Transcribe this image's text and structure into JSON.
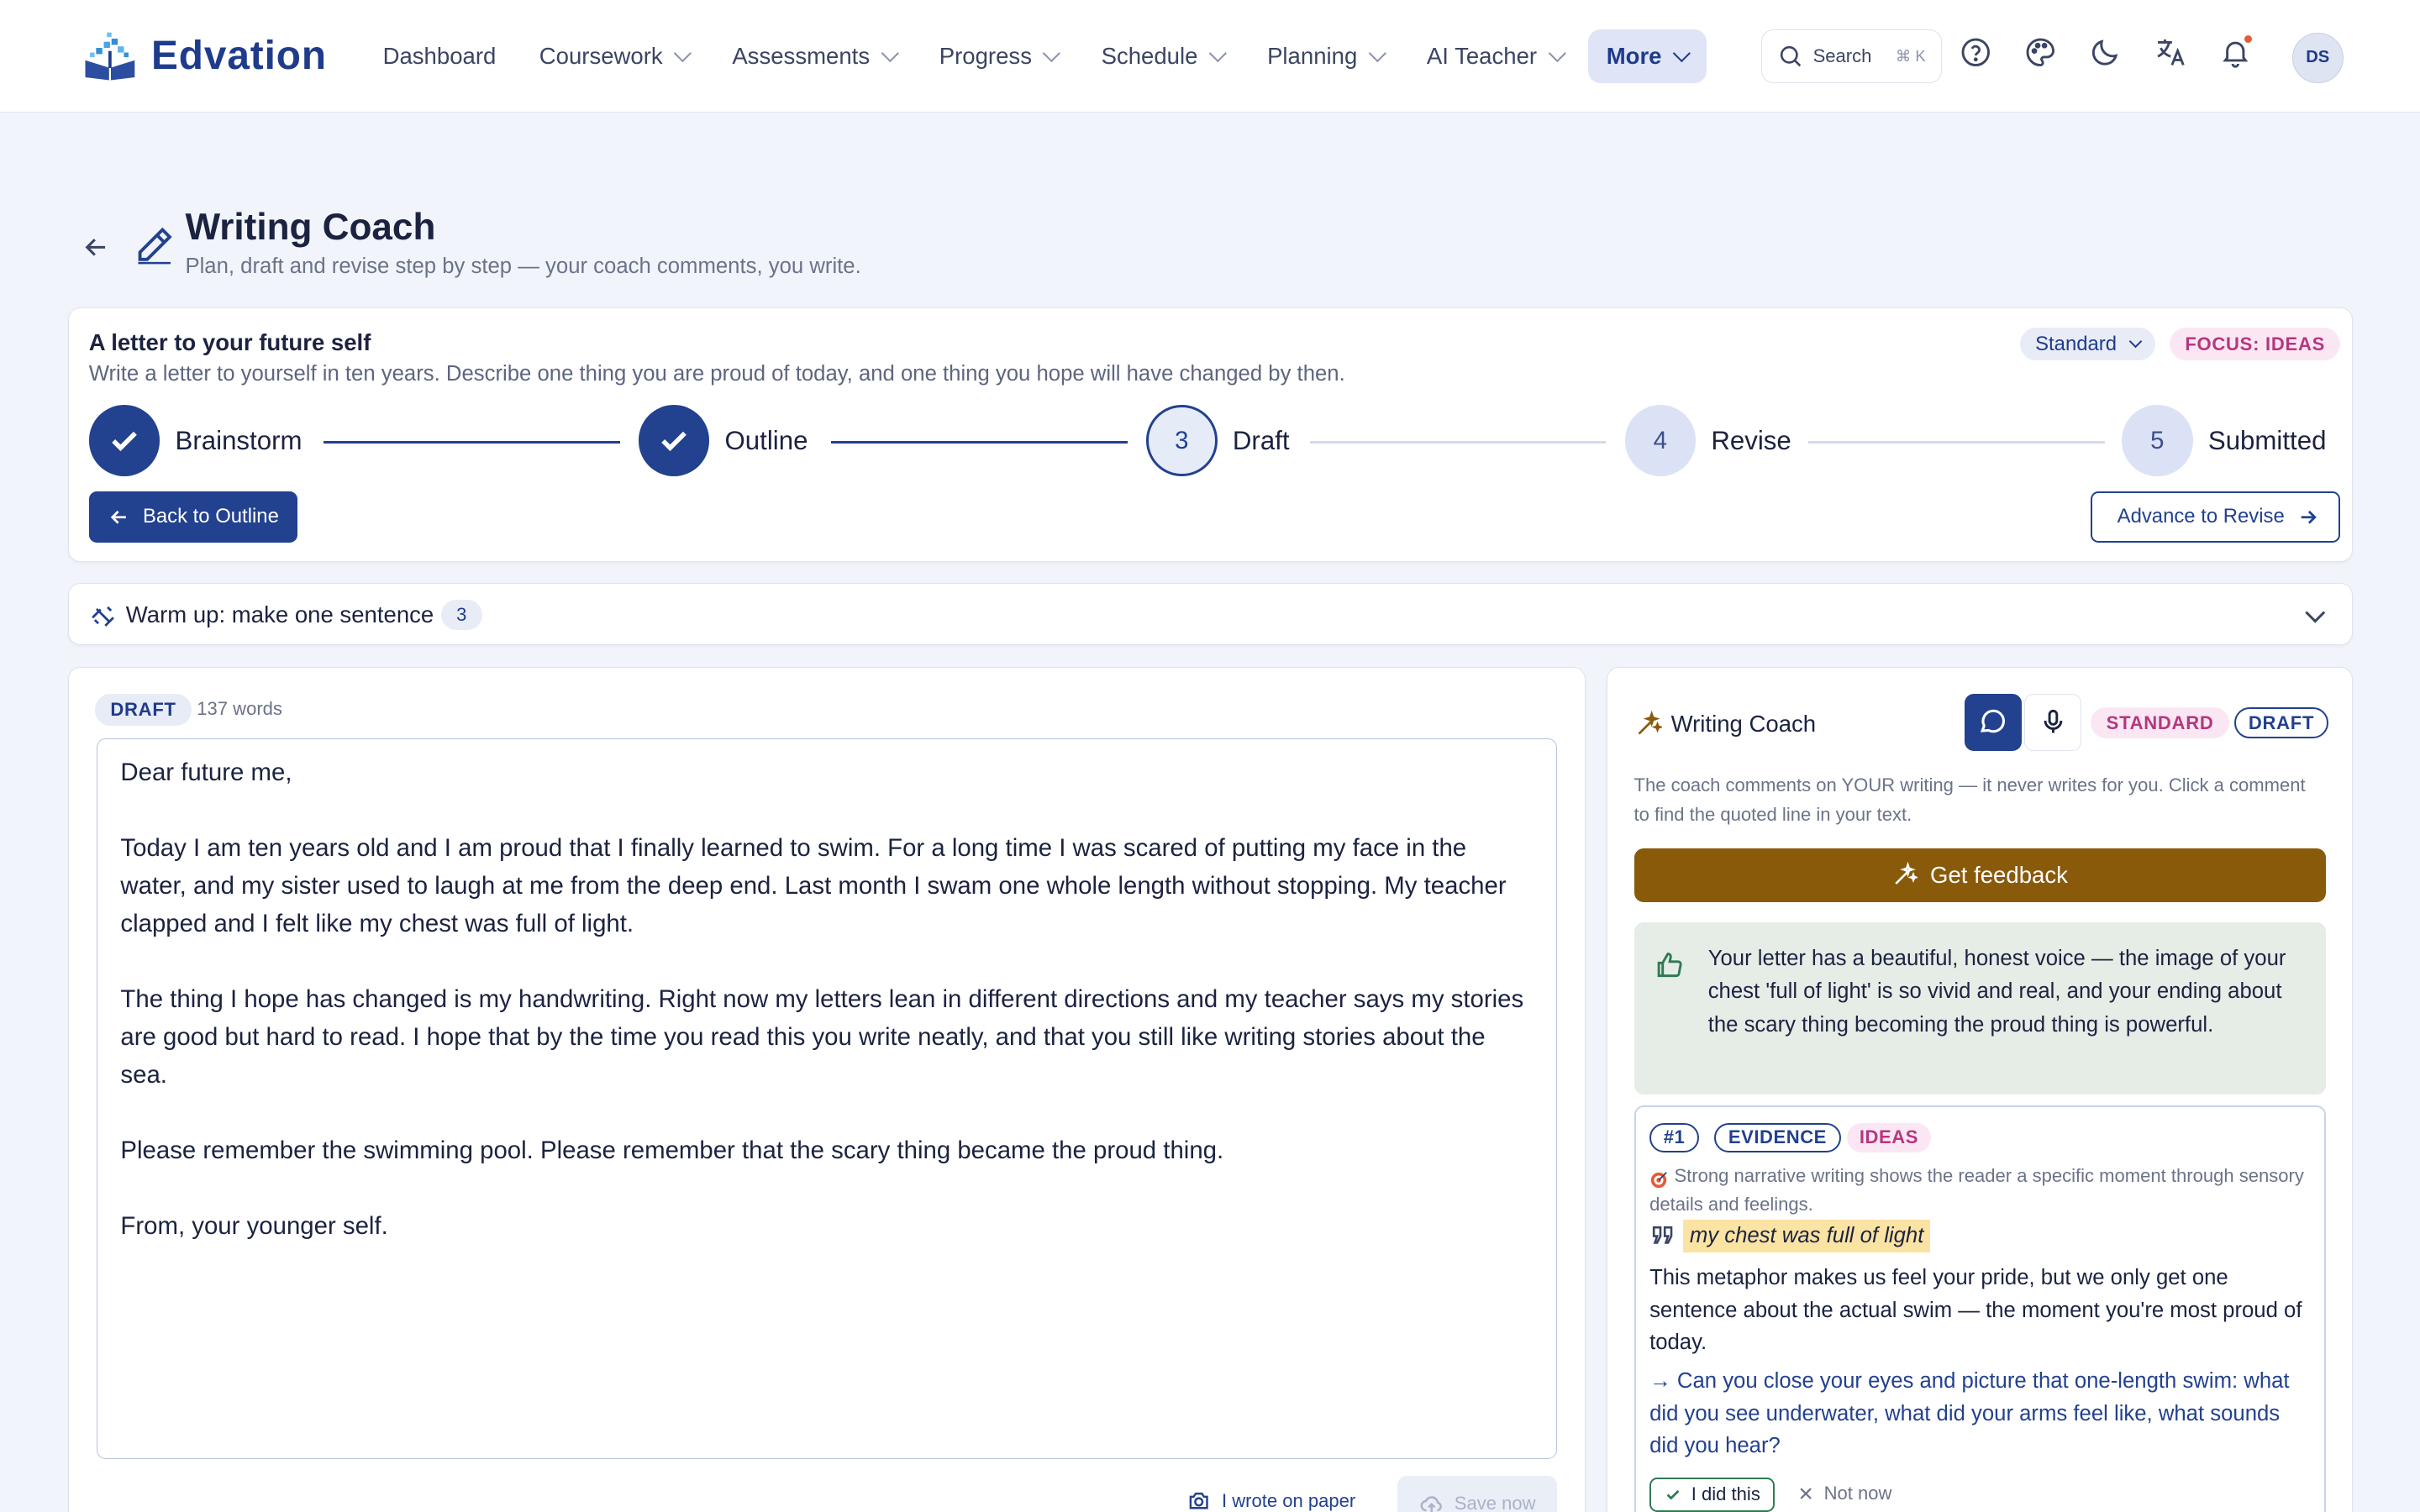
{
  "header": {
    "brand": "Edvation",
    "nav": [
      {
        "label": "Dashboard",
        "has_menu": false
      },
      {
        "label": "Coursework",
        "has_menu": true
      },
      {
        "label": "Assessments",
        "has_menu": true
      },
      {
        "label": "Progress",
        "has_menu": true
      },
      {
        "label": "Schedule",
        "has_menu": true
      },
      {
        "label": "Planning",
        "has_menu": true
      },
      {
        "label": "AI Teacher",
        "has_menu": true
      },
      {
        "label": "More",
        "has_menu": true,
        "active": true
      }
    ],
    "search_label": "Search",
    "search_shortcut": "⌘ K",
    "icons": [
      "help-icon",
      "palette-icon",
      "moon-icon",
      "translate-icon",
      "bell-icon"
    ],
    "avatar_initials": "DS"
  },
  "page": {
    "title": "Writing Coach",
    "subtitle": "Plan, draft and revise step by step — your coach comments, you write."
  },
  "task": {
    "title": "A letter to your future self",
    "description": "Write a letter to yourself in ten years. Describe one thing you are proud of today, and one thing you hope will have changed by then.",
    "level": "Standard",
    "focus": "FOCUS: IDEAS",
    "steps": [
      {
        "number": "1",
        "label": "Brainstorm",
        "status": "done"
      },
      {
        "number": "2",
        "label": "Outline",
        "status": "done"
      },
      {
        "number": "3",
        "label": "Draft",
        "status": "current"
      },
      {
        "number": "4",
        "label": "Revise",
        "status": "todo"
      },
      {
        "number": "5",
        "label": "Submitted",
        "status": "todo"
      }
    ],
    "back_button": "Back to Outline",
    "advance_button": "Advance to Revise"
  },
  "warmup": {
    "label": "Warm up: make one sentence",
    "count": "3"
  },
  "editor": {
    "stage_tag": "DRAFT",
    "word_count": "137 words",
    "paragraphs": [
      "Dear future me,",
      "Today I am ten years old and I am proud that I finally learned to swim. For a long time I was scared of putting my face in the water, and my sister used to laugh at me from the deep end. Last month I swam one whole length without stopping. My teacher clapped and I felt like my chest was full of light.",
      "The thing I hope has changed is my handwriting. Right now my letters lean in different directions and my teacher says my stories are good but hard to read. I hope that by the time you read this you write neatly, and that you still like writing stories about the sea.",
      "Please remember the swimming pool. Please remember that the scary thing became the proud thing.",
      "From, your younger self."
    ],
    "paper_button": "I wrote on paper",
    "save_button": "Save now"
  },
  "coach": {
    "title": "Writing Coach",
    "level_tag": "STANDARD",
    "stage_tag": "DRAFT",
    "note": "The coach comments on YOUR writing — it never writes for you. Click a comment to find the quoted line in your text.",
    "feedback_button": "Get feedback",
    "praise": "Your letter has a beautiful, honest voice — the image of your chest 'full of light' is so vivid and real, and your ending about the scary thing becoming the proud thing is powerful.",
    "comment": {
      "number": "#1",
      "type": "EVIDENCE",
      "trait": "IDEAS",
      "criterion": "Strong narrative writing shows the reader a specific moment through sensory details and feelings.",
      "quote": "my chest was full of light",
      "body": "This metaphor makes us feel your pride, but we only get one sentence about the actual swim — the moment you're most proud of today.",
      "question": "→ Can you close your eyes and picture that one-length swim: what did you see underwater, what did your arms feel like, what sounds did you hear?",
      "done_button": "I did this",
      "dismiss_button": "Not now"
    }
  },
  "colors": {
    "primary": "#22418f",
    "feedback": "#8a5a0b",
    "pink": "#b6367f",
    "praise_bg": "#e6ece6",
    "highlight": "#fbe3a3"
  }
}
